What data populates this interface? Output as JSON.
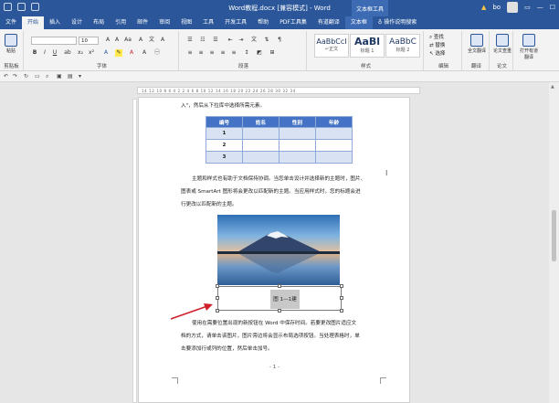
{
  "window": {
    "title": "Word教程.docx [兼容模式] - Word",
    "context_label": "文本框工具",
    "user": "bo",
    "warning_glyph": "▲"
  },
  "tabs": [
    "文件",
    "开始",
    "插入",
    "设计",
    "布局",
    "引用",
    "邮件",
    "审阅",
    "视图",
    "工具",
    "开发工具",
    "帮助",
    "PDF工具集",
    "有道翻译",
    "文本框"
  ],
  "tell_me": "操作说明搜索",
  "ribbon": {
    "font_label": "字体",
    "paragraph_label": "段落",
    "styles_label": "样式",
    "edit_label": "编辑",
    "translate_label": "翻译",
    "paper_label": "论文",
    "clipboard_label": "剪贴板",
    "paste_label": "粘贴",
    "font_size": "10",
    "styles": [
      {
        "sample": "AaBbCcI",
        "name": "↵正文"
      },
      {
        "sample": "AaBl",
        "name": "标题 1"
      },
      {
        "sample": "AaBbC",
        "name": "标题 2"
      }
    ],
    "edit_items": [
      "查找",
      "替换",
      "选择"
    ],
    "translate_btn": "全文翻译",
    "paper_btn": "论文查重",
    "open_btn": "打开有道翻译"
  },
  "ruler_ticks": "14 12 10 8 6 4 2  2 4 6 8 10 12 14 16 18 20 22 24 26 28 30 32 34",
  "document": {
    "intro": "入\"，然后从下拉库中选择所需元素。",
    "table": {
      "headers": [
        "编号",
        "姓名",
        "性别",
        "年龄"
      ],
      "rows": [
        [
          "1",
          "",
          "",
          ""
        ],
        [
          "2",
          "",
          "",
          ""
        ],
        [
          "3",
          "",
          "",
          ""
        ]
      ]
    },
    "para1": [
      "主题和样式也有助于文档保持协调。当您单击设计并选择新的主题时，图片、",
      "图表或 SmartArt 图形将会更改以匹配新的主题。当应用样式时，您的标题会进",
      "行更改以匹配新的主题。"
    ],
    "caption": "图 1—1建",
    "para2": [
      "使用在需要位置出现的新按钮在 Word 中保存时间。若要更改图片适应文",
      "档的方式，请单击该图片，图片旁边将会显示布局选项按钮。当处理表格时，单",
      "击要添加行或列的位置，然后单击加号。"
    ],
    "page_number": "- 1 -"
  },
  "colors": {
    "brand": "#2b579a",
    "table_header": "#4472c4",
    "table_alt": "#d9e2f3",
    "arrow": "#d11f2b"
  }
}
